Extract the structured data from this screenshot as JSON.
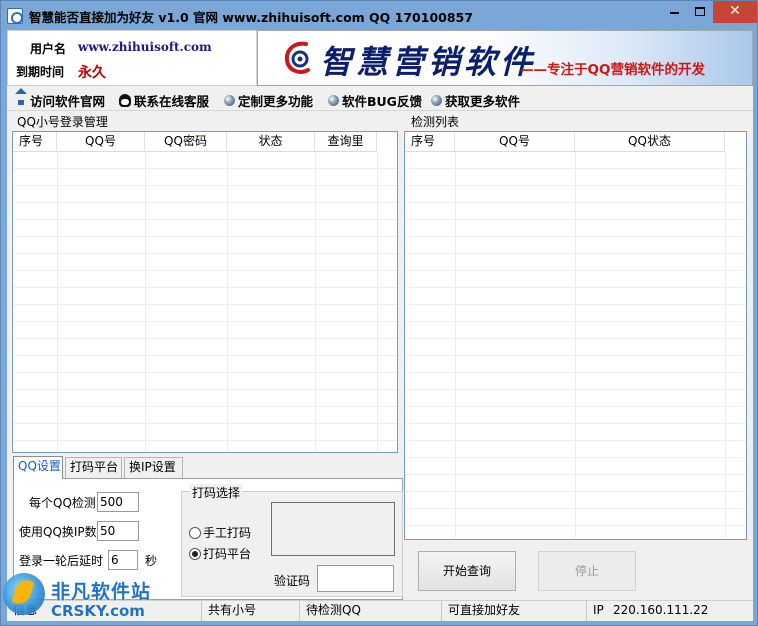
{
  "window": {
    "title": "智慧能否直接加为好友   v1.0    官网    www.zhihuisoft.com    QQ  170100857",
    "minimize": "—",
    "maximize": "□",
    "close": "✕"
  },
  "user": {
    "username_label": "用户名",
    "username_value": "www.zhihuisoft.com",
    "expiry_label": "到期时间",
    "expiry_value": "永久"
  },
  "banner": {
    "brand": "智慧营销软件",
    "slogan": "——专注于QQ营销软件的开发",
    "colors": {
      "brand": "#0c1f6e",
      "slogan": "#d21414"
    }
  },
  "toolbar": {
    "items": [
      {
        "label": "访问软件官网",
        "icon": "home-icon"
      },
      {
        "label": "联系在线客服",
        "icon": "qq-penguin-icon"
      },
      {
        "label": "定制更多功能",
        "icon": "orb-icon"
      },
      {
        "label": "软件BUG反馈",
        "icon": "orb-icon"
      },
      {
        "label": "获取更多软件",
        "icon": "orb-icon"
      }
    ]
  },
  "left_panel": {
    "title": "QQ小号登录管理",
    "columns": [
      "序号",
      "QQ号",
      "QQ密码",
      "状态",
      "查询里"
    ]
  },
  "right_panel": {
    "title": "检测列表",
    "columns": [
      "序号",
      "QQ号",
      "QQ状态"
    ]
  },
  "tabs": {
    "items": [
      "QQ设置",
      "打码平台",
      "换IP设置"
    ],
    "active": "QQ设置"
  },
  "qq_settings": {
    "per_qq_check_label": "每个QQ检测",
    "per_qq_check_value": "500",
    "switch_ip_label": "使用QQ换IP数",
    "switch_ip_value": "50",
    "delay_label": "登录一轮后延时",
    "delay_value": "6",
    "delay_unit": "秒"
  },
  "captcha": {
    "group_title": "打码选择",
    "options": [
      {
        "label": "手工打码",
        "checked": false
      },
      {
        "label": "打码平台",
        "checked": true
      }
    ],
    "code_label": "验证码",
    "code_value": ""
  },
  "buttons": {
    "start": "开始查询",
    "stop": "停止"
  },
  "statusbar": {
    "cell1": "信息",
    "cell2": "共有小号",
    "cell3": "待检测QQ",
    "cell4": "可直接加好友",
    "ip_label": "IP",
    "ip_value": "220.160.111.22"
  },
  "watermark": {
    "cn": "非凡软件站",
    "en": "CRSKY.com"
  }
}
